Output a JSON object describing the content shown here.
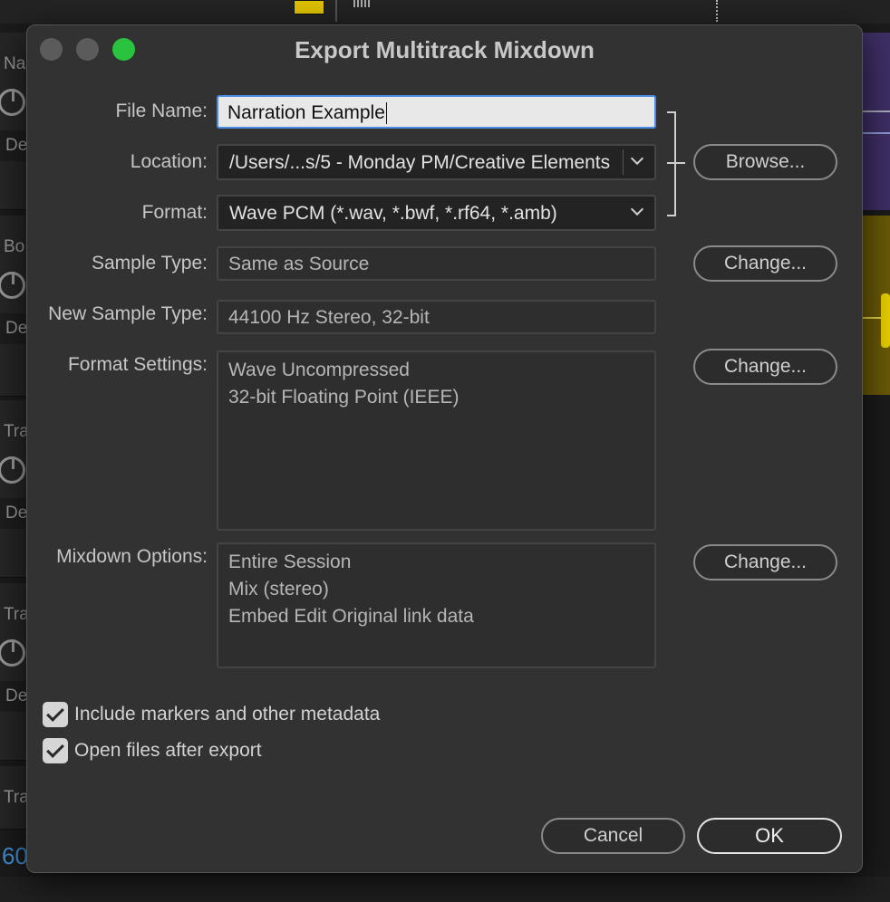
{
  "dialog": {
    "title": "Export Multitrack Mixdown",
    "file_name_label": "File Name:",
    "file_name_value": "Narration Example",
    "location_label": "Location:",
    "location_value": "/Users/...s/5 - Monday PM/Creative Elements",
    "format_label": "Format:",
    "format_value": "Wave PCM (*.wav, *.bwf, *.rf64, *.amb)",
    "browse_label": "Browse...",
    "sample_type_label": "Sample Type:",
    "sample_type_value": "Same as Source",
    "new_sample_type_label": "New Sample Type:",
    "new_sample_type_value": "44100 Hz Stereo, 32-bit",
    "format_settings_label": "Format Settings:",
    "format_settings_lines": [
      "Wave Uncompressed",
      "32-bit Floating Point (IEEE)"
    ],
    "mixdown_options_label": "Mixdown Options:",
    "mixdown_options_lines": [
      "Entire Session",
      "Mix (stereo)",
      "Embed Edit Original link data"
    ],
    "change_label": "Change...",
    "include_markers_label": "Include markers and other metadata",
    "include_markers_checked": true,
    "open_files_label": "Open files after export",
    "open_files_checked": true,
    "cancel_label": "Cancel",
    "ok_label": "OK"
  },
  "background": {
    "tracks": [
      {
        "name": "Na",
        "sub": "De"
      },
      {
        "name": "Bo",
        "sub": "De"
      },
      {
        "name": "Tra",
        "sub": "De"
      },
      {
        "name": "Tra",
        "sub": "De"
      },
      {
        "name": "Tra",
        "sub": ""
      }
    ],
    "time_display": "60"
  },
  "colors": {
    "dialog_bg": "#323232",
    "focus_ring": "#4b8be6",
    "zoom_button": "#29c33f",
    "time_blue": "#3f8fd6"
  }
}
